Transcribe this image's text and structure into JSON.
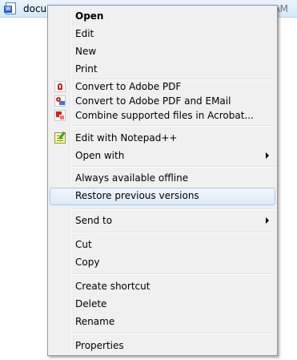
{
  "file": {
    "name": "docu",
    "time": "5 AM"
  },
  "menu": {
    "open": "Open",
    "edit": "Edit",
    "new": "New",
    "print": "Print",
    "convert_pdf": "Convert to Adobe PDF",
    "convert_pdf_email": "Convert to Adobe PDF and EMail",
    "combine_acrobat": "Combine supported files in Acrobat...",
    "edit_notepad": "Edit with Notepad++",
    "open_with": "Open with",
    "always_offline": "Always available offline",
    "restore_versions": "Restore previous versions",
    "send_to": "Send to",
    "cut": "Cut",
    "copy": "Copy",
    "create_shortcut": "Create shortcut",
    "delete": "Delete",
    "rename": "Rename",
    "properties": "Properties"
  },
  "icons": {
    "file": "word-document-icon",
    "convert_pdf": "adobe-pdf-icon",
    "convert_pdf_email": "adobe-pdf-email-icon",
    "combine_acrobat": "acrobat-combine-icon",
    "edit_notepad": "notepad-plus-plus-icon"
  },
  "colors": {
    "menu_bg": "#f0f0f0",
    "menu_border": "#979797",
    "hover_border": "#a8c7ea",
    "selection_bg": "#d6e9f9"
  }
}
